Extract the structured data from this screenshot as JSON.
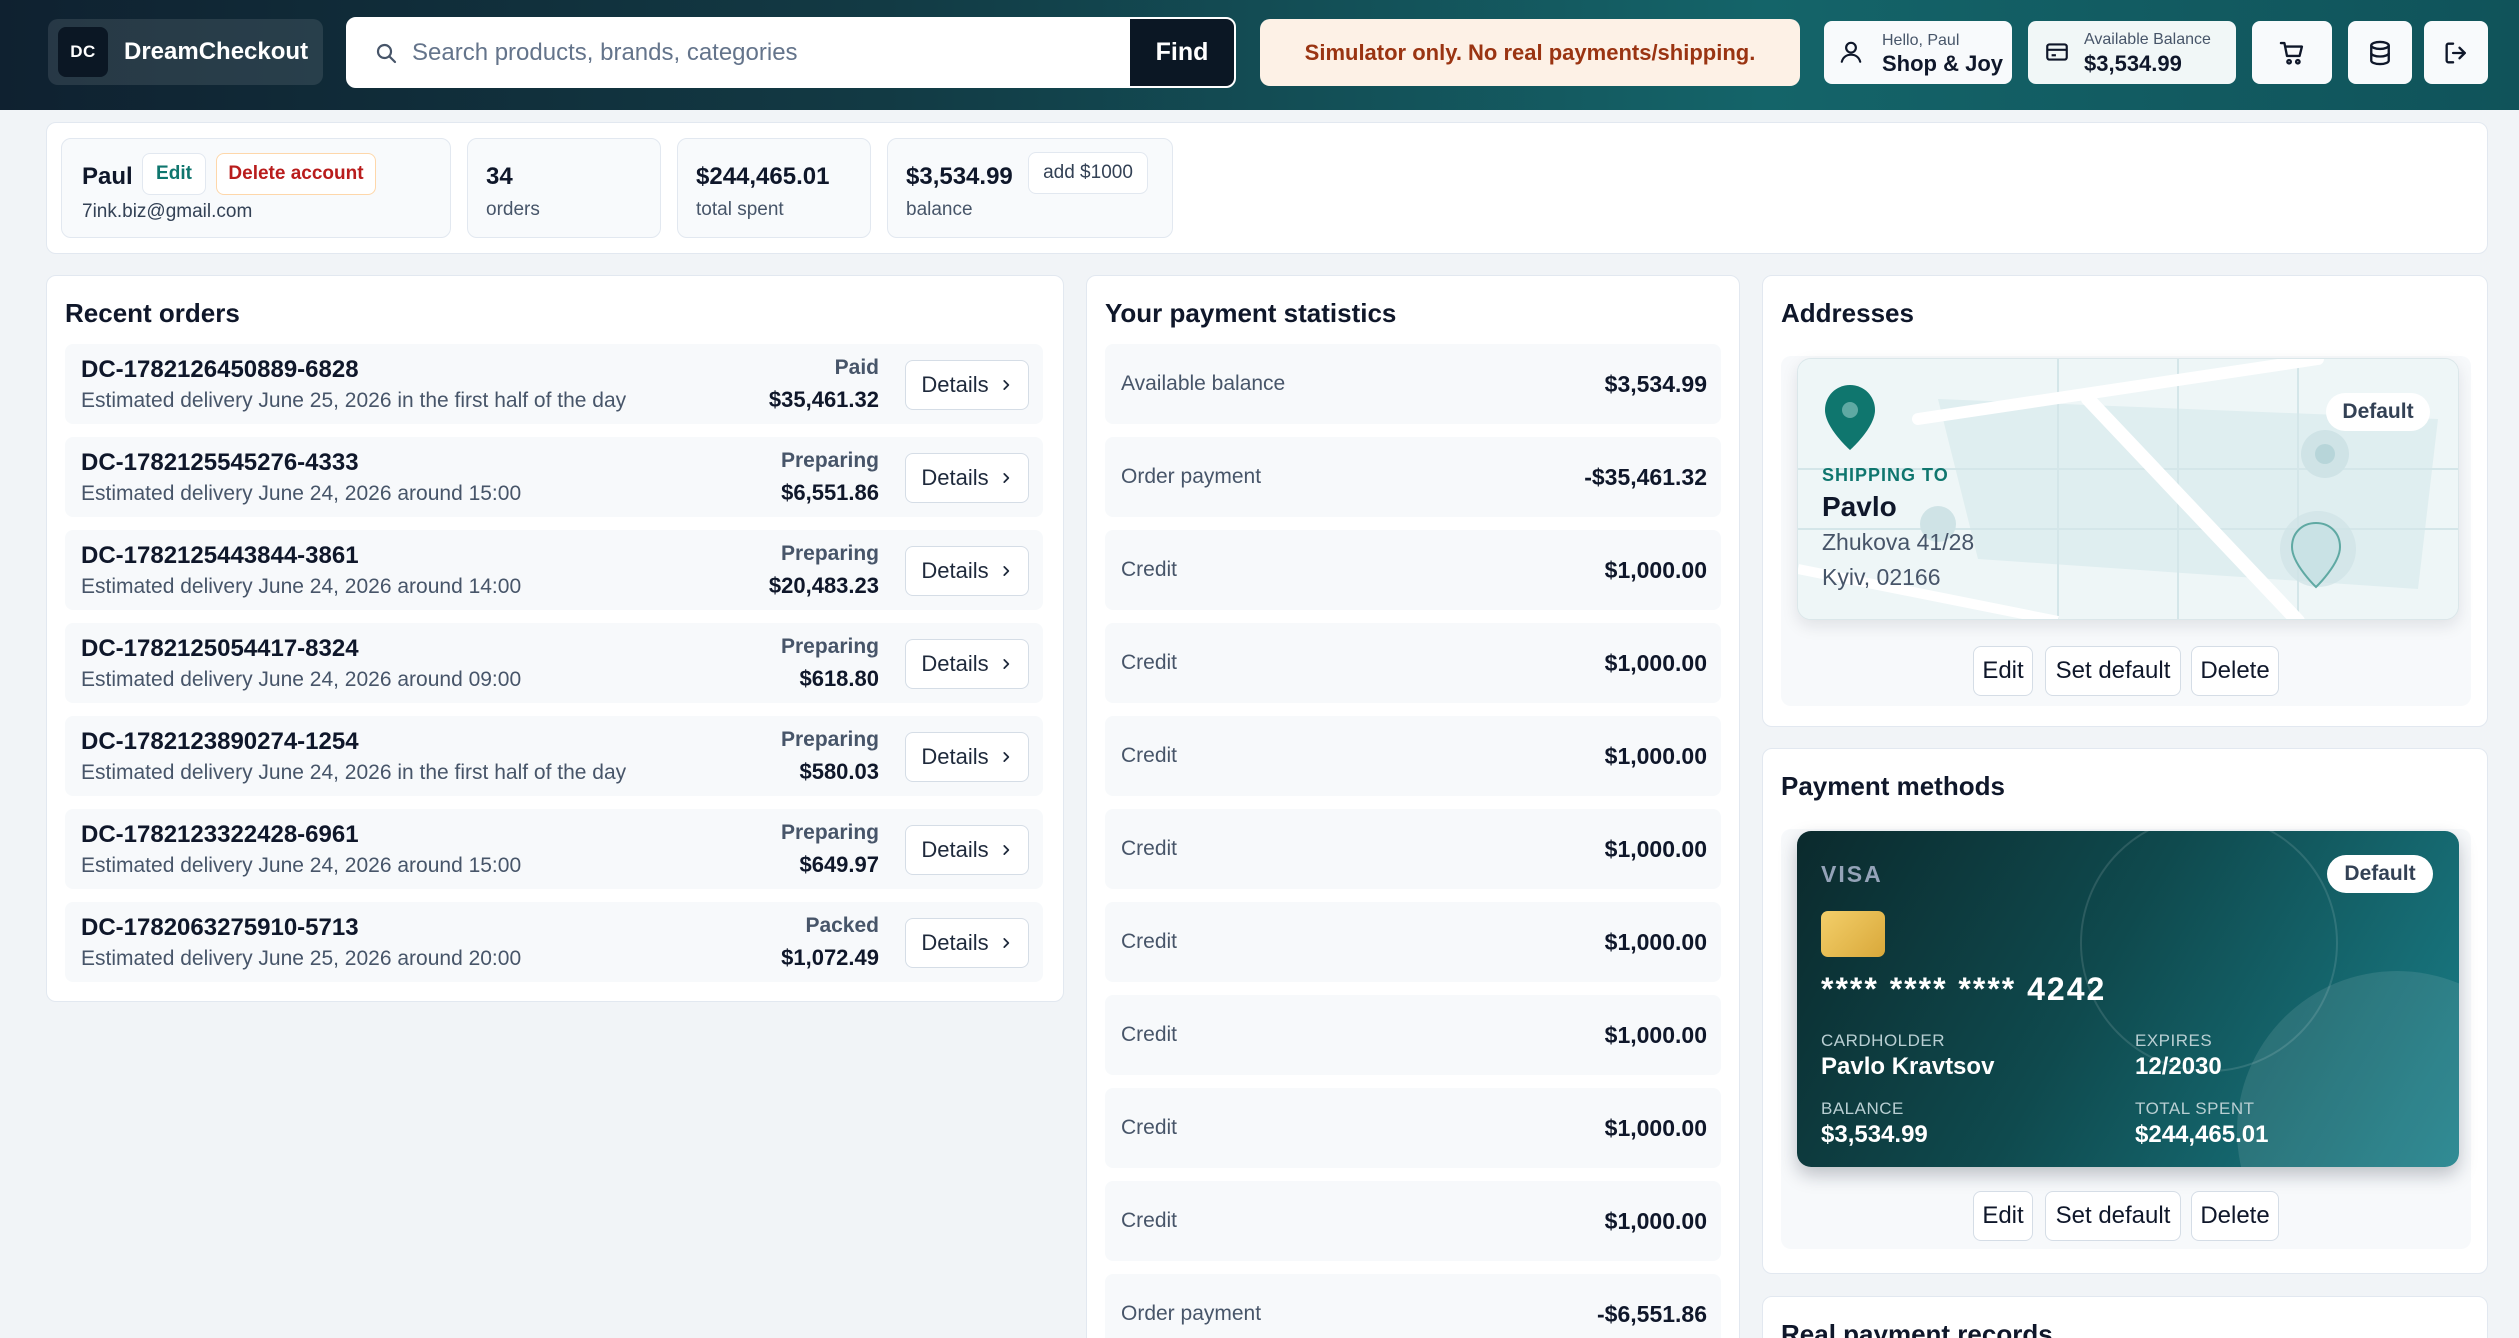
{
  "header": {
    "brand_logo": "DC",
    "brand_name": "DreamCheckout",
    "search_placeholder": "Search products, brands, categories",
    "find_label": "Find",
    "simulator_notice": "Simulator only. No real payments/shipping.",
    "user_greeting": "Hello, Paul",
    "user_shop": "Shop & Joy",
    "balance_label": "Available Balance",
    "balance_value": "$3,534.99",
    "icons": [
      "user-icon",
      "wallet-icon",
      "cart-icon",
      "database-icon",
      "logout-icon"
    ]
  },
  "profile": {
    "name": "Paul",
    "edit_label": "Edit",
    "delete_label": "Delete account",
    "email": "7ink.biz@gmail.com",
    "orders_value": "34",
    "orders_label": "orders",
    "spent_value": "$244,465.01",
    "spent_label": "total spent",
    "balance_value": "$3,534.99",
    "balance_label": "balance",
    "add_label": "add $1000"
  },
  "recent_orders": {
    "title": "Recent orders",
    "details_label": "Details",
    "items": [
      {
        "id": "DC-1782126450889-6828",
        "eta": "Estimated delivery June 25, 2026 in the first half of the day",
        "status": "Paid",
        "amount": "$35,461.32"
      },
      {
        "id": "DC-1782125545276-4333",
        "eta": "Estimated delivery June 24, 2026 around 15:00",
        "status": "Preparing",
        "amount": "$6,551.86"
      },
      {
        "id": "DC-1782125443844-3861",
        "eta": "Estimated delivery June 24, 2026 around 14:00",
        "status": "Preparing",
        "amount": "$20,483.23"
      },
      {
        "id": "DC-1782125054417-8324",
        "eta": "Estimated delivery June 24, 2026 around 09:00",
        "status": "Preparing",
        "amount": "$618.80"
      },
      {
        "id": "DC-1782123890274-1254",
        "eta": "Estimated delivery June 24, 2026 in the first half of the day",
        "status": "Preparing",
        "amount": "$580.03"
      },
      {
        "id": "DC-1782123322428-6961",
        "eta": "Estimated delivery June 24, 2026 around 15:00",
        "status": "Preparing",
        "amount": "$649.97"
      },
      {
        "id": "DC-1782063275910-5713",
        "eta": "Estimated delivery June 25, 2026 around 20:00",
        "status": "Packed",
        "amount": "$1,072.49"
      }
    ]
  },
  "payment_stats": {
    "title": "Your payment statistics",
    "rows": [
      {
        "label": "Available balance",
        "value": "$3,534.99"
      },
      {
        "label": "Order payment",
        "value": "-$35,461.32"
      },
      {
        "label": "Credit",
        "value": "$1,000.00"
      },
      {
        "label": "Credit",
        "value": "$1,000.00"
      },
      {
        "label": "Credit",
        "value": "$1,000.00"
      },
      {
        "label": "Credit",
        "value": "$1,000.00"
      },
      {
        "label": "Credit",
        "value": "$1,000.00"
      },
      {
        "label": "Credit",
        "value": "$1,000.00"
      },
      {
        "label": "Credit",
        "value": "$1,000.00"
      },
      {
        "label": "Credit",
        "value": "$1,000.00"
      },
      {
        "label": "Order payment",
        "value": "-$6,551.86"
      }
    ]
  },
  "addresses": {
    "title": "Addresses",
    "default_tag": "Default",
    "shipping_label": "SHIPPING TO",
    "name": "Pavlo",
    "line1": "Zhukova 41/28",
    "line2": "Kyiv, 02166",
    "edit_label": "Edit",
    "set_default_label": "Set default",
    "delete_label": "Delete"
  },
  "payment_methods": {
    "title": "Payment methods",
    "brand": "VISA",
    "default_tag": "Default",
    "number": "**** **** **** 4242",
    "cardholder_label": "CARDHOLDER",
    "cardholder": "Pavlo Kravtsov",
    "expires_label": "EXPIRES",
    "expires": "12/2030",
    "balance_label": "BALANCE",
    "balance": "$3,534.99",
    "spent_label": "TOTAL SPENT",
    "spent": "$244,465.01",
    "edit_label": "Edit",
    "set_default_label": "Set default",
    "delete_label": "Delete"
  },
  "real_records": {
    "title": "Real payment records"
  },
  "colors": {
    "accent": "#0f766e",
    "danger": "#b91c1c",
    "header_dark": "#0f2130",
    "header_teal": "#146469"
  }
}
